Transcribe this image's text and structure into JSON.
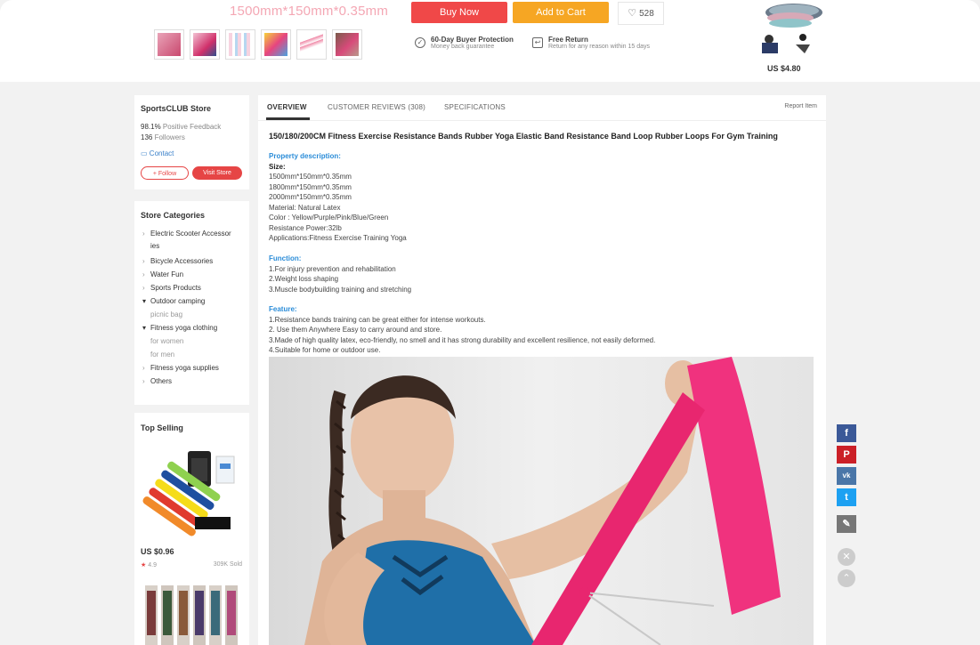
{
  "topbar": {
    "variant_text": "1500mm*150mm*0.35mm",
    "buy_now": "Buy Now",
    "add_to_cart": "Add to Cart",
    "wishlist_count": "528",
    "guarantees": [
      {
        "title": "60-Day Buyer Protection",
        "sub": "Money back guarantee"
      },
      {
        "title": "Free Return",
        "sub": "Return for any reason within 15 days"
      }
    ],
    "corner_price": "US $4.80"
  },
  "store": {
    "name": "SportsCLUB Store",
    "feedback_value": "98.1%",
    "feedback_label": "Positive Feedback",
    "followers_value": "136",
    "followers_label": "Followers",
    "contact": "Contact",
    "follow": "+ Follow",
    "visit": "Visit Store"
  },
  "categories": {
    "title": "Store Categories",
    "items": [
      {
        "label": "Electric Scooter Accessor ies",
        "marker": "›",
        "sub": false
      },
      {
        "label": "Bicycle Accessories",
        "marker": "›",
        "sub": false
      },
      {
        "label": "Water Fun",
        "marker": "›",
        "sub": false
      },
      {
        "label": "Sports Products",
        "marker": "›",
        "sub": false
      },
      {
        "label": "Outdoor camping",
        "marker": "▾",
        "sub": false
      },
      {
        "label": "picnic bag",
        "marker": "",
        "sub": true
      },
      {
        "label": "Fitness yoga clothing",
        "marker": "▾",
        "sub": false
      },
      {
        "label": "for women",
        "marker": "",
        "sub": true
      },
      {
        "label": "for men",
        "marker": "",
        "sub": true
      },
      {
        "label": "Fitness yoga supplies",
        "marker": "›",
        "sub": false
      },
      {
        "label": "Others",
        "marker": "›",
        "sub": false
      }
    ]
  },
  "top_selling": {
    "title": "Top Selling",
    "price": "US $0.96",
    "rating": "4.9",
    "sold": "309K Sold"
  },
  "tabs": {
    "overview": "OVERVIEW",
    "reviews": "CUSTOMER REVIEWS (308)",
    "specs": "SPECIFICATIONS",
    "report": "Report Item"
  },
  "product": {
    "title": "150/180/200CM Fitness Exercise Resistance Bands Rubber Yoga Elastic Band Resistance Band Loop Rubber Loops For Gym Training",
    "property_heading": "Property description:",
    "size_label": "Size:",
    "property_lines": [
      "1500mm*150mm*0.35mm",
      "1800mm*150mm*0.35mm",
      "2000mm*150mm*0.35mm",
      "Material: Natural Latex",
      "Color : Yellow/Purple/Pink/Blue/Green",
      "Resistance Power:32lb",
      "Applications:Fitness Exercise Training Yoga"
    ],
    "function_heading": "Function:",
    "function_lines": [
      "1.For injury prevention and rehabilitation",
      "2.Weight loss shaping",
      "3.Muscle bodybuilding training and stretching"
    ],
    "feature_heading": "Feature:",
    "feature_lines": [
      "1.Resistance bands training can be great either for intense workouts.",
      "2. Use them Anywhere Easy to carry around and store.",
      "3.Made of high quality latex, eco-friendly, no smell and it  has strong durability and excellent resilience, not easily deformed.",
      "4.Suitable for home or outdoor use."
    ]
  },
  "share": {
    "facebook": "f",
    "pinterest": "P",
    "vk": "vk",
    "twitter": "t",
    "edit": "✎",
    "close": "✕",
    "up": "⌃"
  },
  "colors": {
    "buy_now": "#f04848",
    "add_to_cart": "#f6a623",
    "link_blue": "#2a8cd8",
    "accent_red": "#e64545"
  }
}
